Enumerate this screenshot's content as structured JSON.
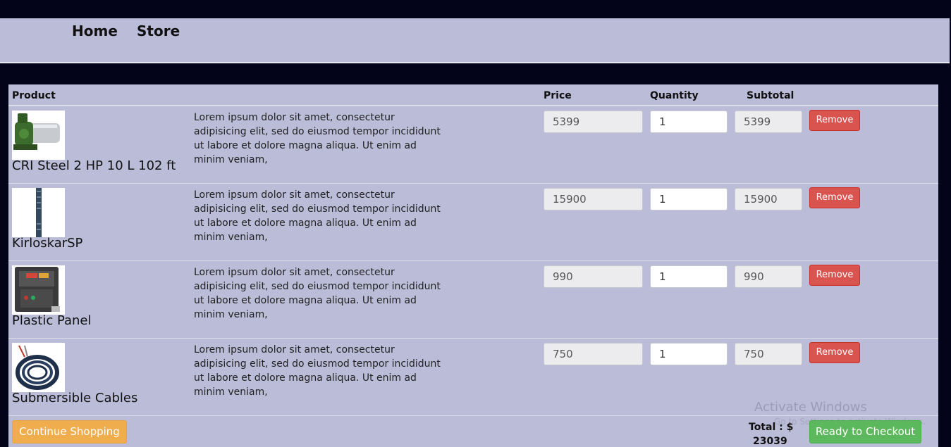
{
  "nav": {
    "home": "Home",
    "store": "Store"
  },
  "table": {
    "headers": {
      "product": "Product",
      "price": "Price",
      "quantity": "Quantity",
      "subtotal": "Subtotal"
    },
    "rows": [
      {
        "name": "CRI Steel 2 HP 10 L 102 ft",
        "description": "Lorem ipsum dolor sit amet, consectetur adipisicing elit, sed do eiusmod tempor incididunt ut labore et dolore magna aliqua. Ut enim ad minim veniam,",
        "price": "5399",
        "quantity": "1",
        "subtotal": "5399",
        "remove": "Remove",
        "image_icon": "pump-icon"
      },
      {
        "name": "KirloskarSP",
        "description": "Lorem ipsum dolor sit amet, consectetur adipisicing elit, sed do eiusmod tempor incididunt ut labore et dolore magna aliqua. Ut enim ad minim veniam,",
        "price": "15900",
        "quantity": "1",
        "subtotal": "15900",
        "remove": "Remove",
        "image_icon": "submersible-pump-icon"
      },
      {
        "name": "Plastic Panel",
        "description": "Lorem ipsum dolor sit amet, consectetur adipisicing elit, sed do eiusmod tempor incididunt ut labore et dolore magna aliqua. Ut enim ad minim veniam,",
        "price": "990",
        "quantity": "1",
        "subtotal": "990",
        "remove": "Remove",
        "image_icon": "control-panel-icon"
      },
      {
        "name": "Submersible Cables",
        "description": "Lorem ipsum dolor sit amet, consectetur adipisicing elit, sed do eiusmod tempor incididunt ut labore et dolore magna aliqua. Ut enim ad minim veniam,",
        "price": "750",
        "quantity": "1",
        "subtotal": "750",
        "remove": "Remove",
        "image_icon": "cable-coil-icon"
      }
    ]
  },
  "footer": {
    "continue": "Continue Shopping",
    "total_label": "Total : $",
    "total_value": "23039",
    "checkout": "Ready to Checkout"
  },
  "watermark": {
    "title": "Activate Windows",
    "subtitle": "Go to Settings to activate Windows."
  },
  "colors": {
    "background": "#03041a",
    "panel": "#babcd8",
    "remove": "#d9534f",
    "continue": "#f0ad4e",
    "checkout": "#5cb85c"
  }
}
